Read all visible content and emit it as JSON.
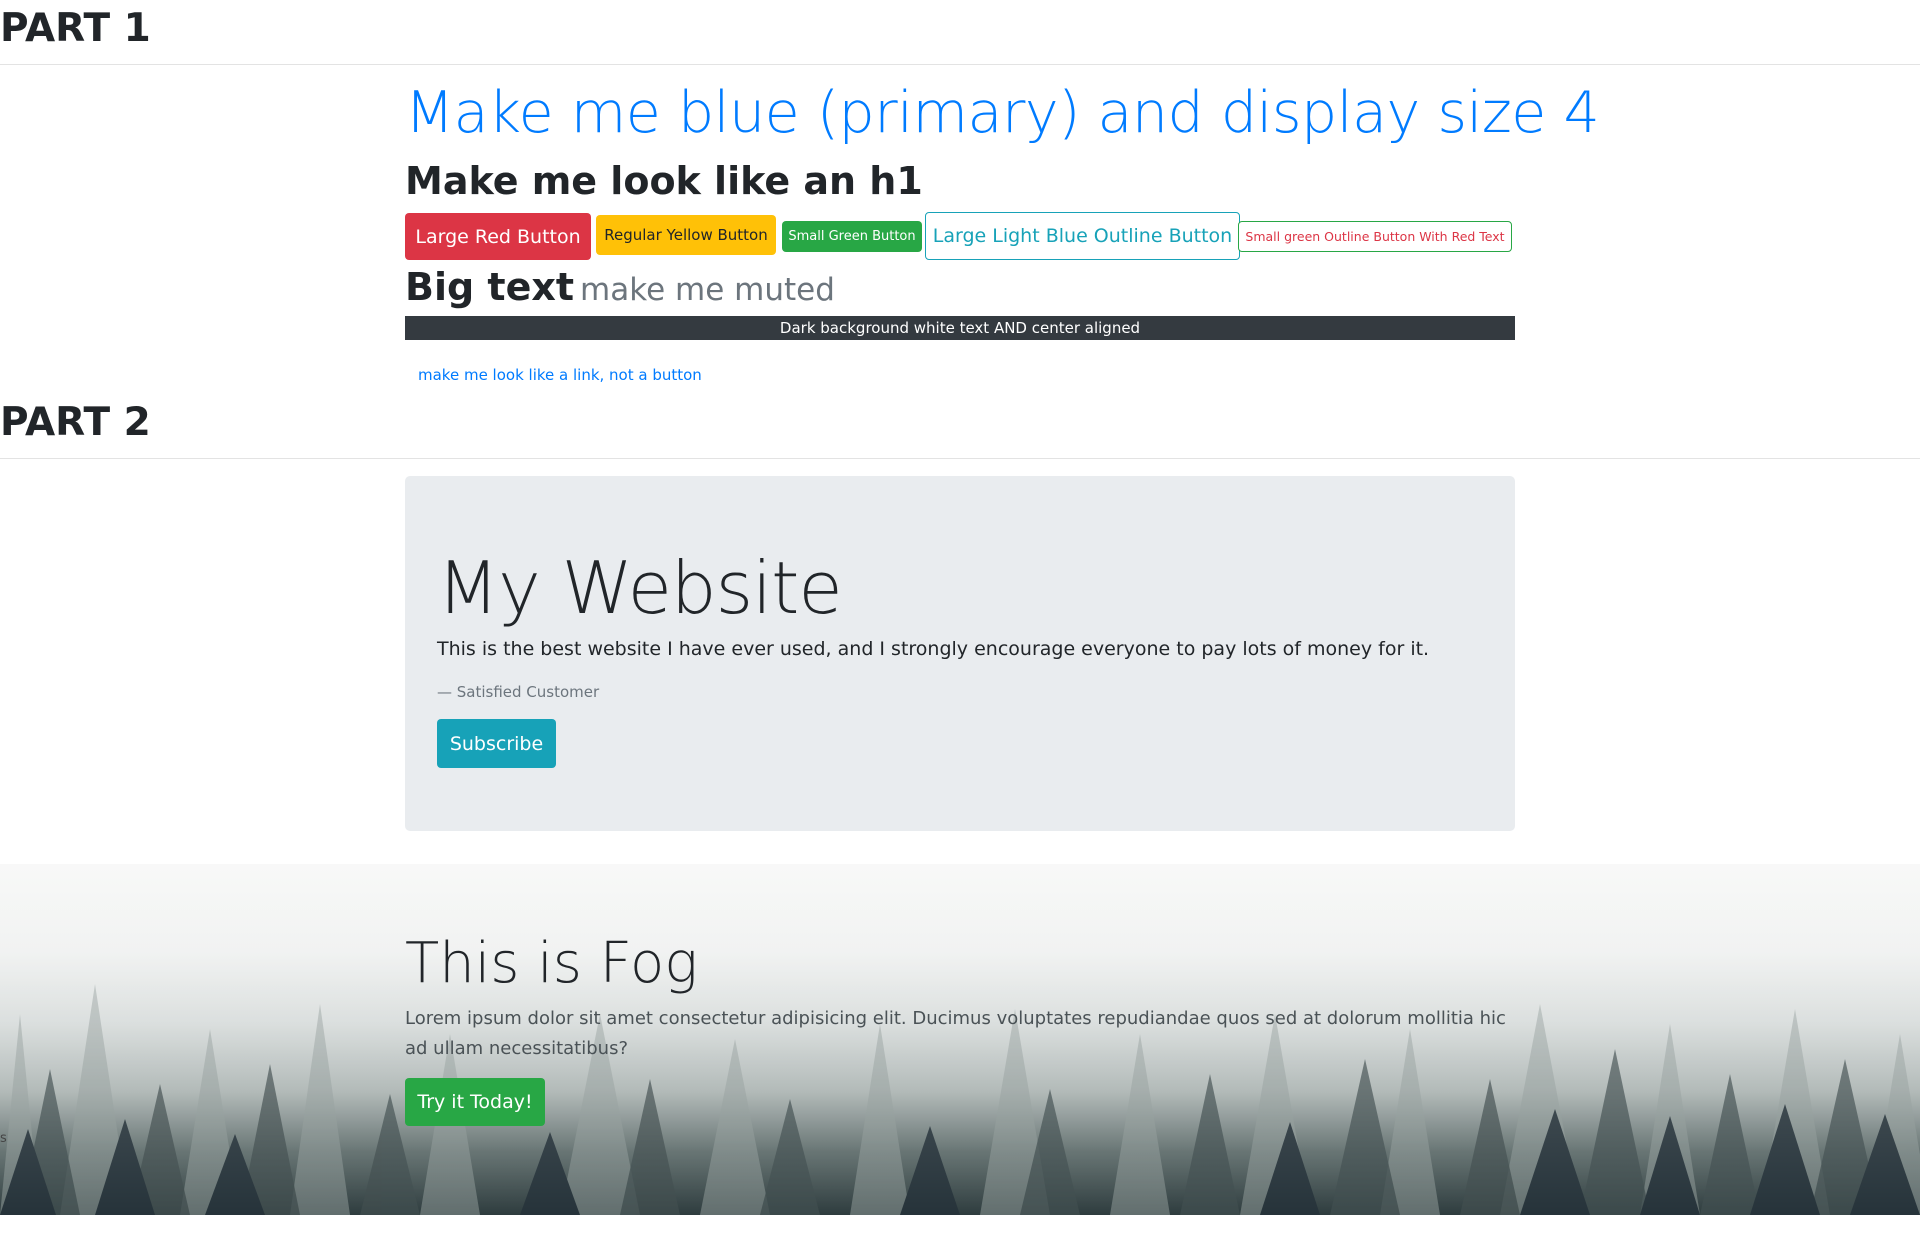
{
  "part1": {
    "title": "PART 1"
  },
  "part2": {
    "title": "PART 2"
  },
  "display_heading": "Make me blue (primary) and display size 4",
  "h1_look": "Make me look like an h1",
  "buttons": {
    "large_red": "Large Red Button",
    "regular_yellow": "Regular Yellow Button",
    "small_green": "Small Green Button",
    "large_outline": "Large Light Blue Outline Button",
    "small_outline": "Small green Outline Button With Red Text"
  },
  "big_text": "Big text",
  "muted_text": "make me muted",
  "dark_bar": "Dark background white text AND center aligned",
  "link_button": "make me look like a link, not a button",
  "jumbotron": {
    "title": "My Website",
    "lead": "This is the best website I have ever used, and I strongly encourage everyone to pay lots of money for it.",
    "footer": "— Satisfied Customer",
    "button": "Subscribe"
  },
  "fog": {
    "title": "This is Fog",
    "text": "Lorem ipsum dolor sit amet consectetur adipisicing elit. Ducimus voluptates repudiandae quos sed at dolorum mollitia hic ad ullam necessitatibus?",
    "button": "Try it Today!"
  },
  "stray_char": "s",
  "colors": {
    "primary": "#007bff",
    "danger": "#dc3545",
    "warning": "#ffc107",
    "success": "#28a745",
    "info": "#17a2b8",
    "dark": "#343a40",
    "muted": "#6c757d",
    "jumbotron_bg": "#e9ecef"
  }
}
